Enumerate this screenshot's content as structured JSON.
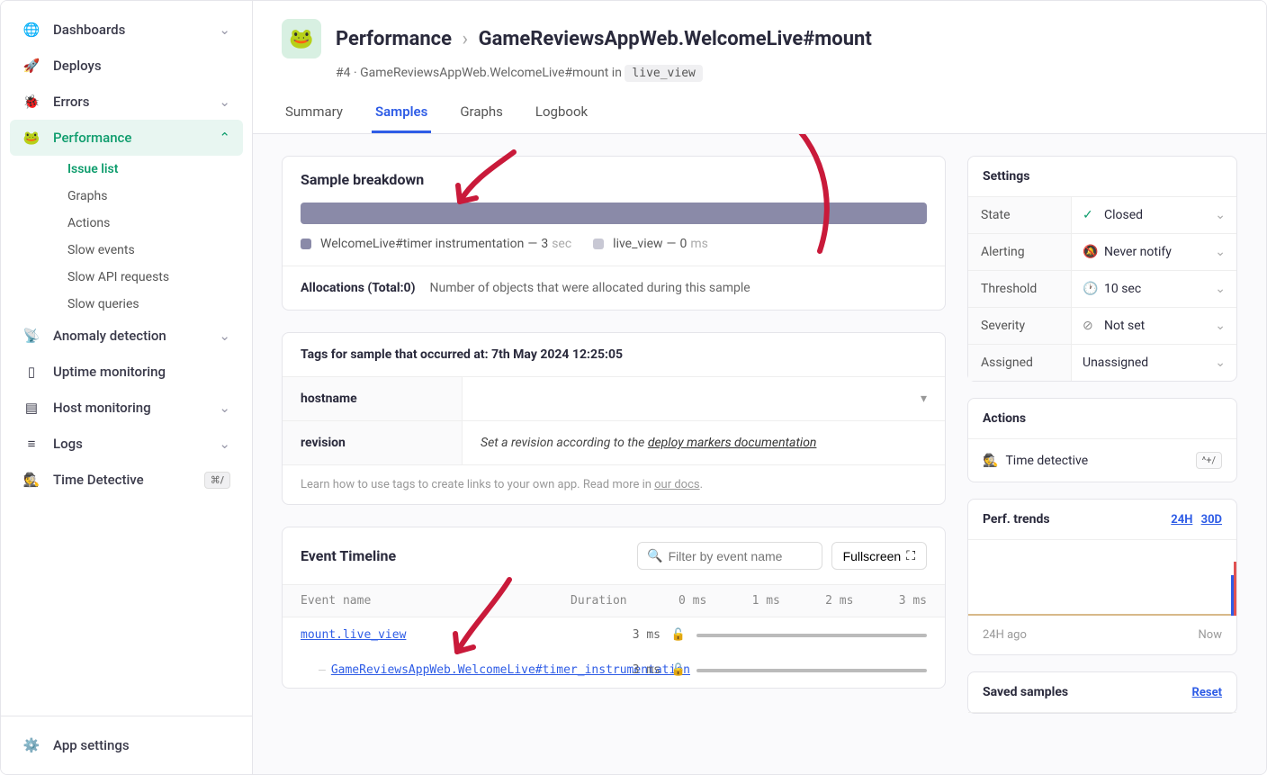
{
  "sidebar": {
    "items": [
      {
        "label": "Dashboards",
        "icon": "globe"
      },
      {
        "label": "Deploys",
        "icon": "rocket"
      },
      {
        "label": "Errors",
        "icon": "bug"
      },
      {
        "label": "Performance",
        "icon": "frog",
        "active": true
      },
      {
        "label": "Anomaly detection",
        "icon": "radar"
      },
      {
        "label": "Uptime monitoring",
        "icon": "monitor"
      },
      {
        "label": "Host monitoring",
        "icon": "server"
      },
      {
        "label": "Logs",
        "icon": "list"
      },
      {
        "label": "Time Detective",
        "icon": "detective",
        "kbd": "⌘/"
      }
    ],
    "perf_sub": [
      {
        "label": "Issue list",
        "active": true
      },
      {
        "label": "Graphs"
      },
      {
        "label": "Actions"
      },
      {
        "label": "Slow events"
      },
      {
        "label": "Slow API requests"
      },
      {
        "label": "Slow queries"
      }
    ],
    "settings_label": "App settings"
  },
  "header": {
    "breadcrumb_root": "Performance",
    "breadcrumb_page": "GameReviewsAppWeb.WelcomeLive#mount",
    "sub_prefix": "#4 · GameReviewsAppWeb.WelcomeLive#mount in",
    "sub_code": "live_view",
    "tabs": [
      "Summary",
      "Samples",
      "Graphs",
      "Logbook"
    ],
    "active_tab": "Samples"
  },
  "breakdown": {
    "title": "Sample breakdown",
    "legend": [
      {
        "color": "#8a8aa8",
        "label": "WelcomeLive#timer instrumentation",
        "value": "3",
        "unit": "sec"
      },
      {
        "color": "#c8c8d4",
        "label": "live_view",
        "value": "0",
        "unit": "ms"
      }
    ],
    "alloc_title": "Allocations (Total:0)",
    "alloc_desc": "Number of objects that were allocated during this sample"
  },
  "tags": {
    "title": "Tags for sample that occurred at: 7th May 2024 12:25:05",
    "rows": [
      {
        "key": "hostname",
        "value": ""
      },
      {
        "key": "revision",
        "value_prefix": "Set a revision according to the ",
        "value_link": "deploy markers documentation"
      }
    ],
    "footer_prefix": "Learn how to use tags to create links to your own app. Read more in ",
    "footer_link": "our docs",
    "footer_suffix": "."
  },
  "timeline": {
    "title": "Event Timeline",
    "filter_placeholder": "Filter by event name",
    "fullscreen_label": "Fullscreen",
    "col_event": "Event name",
    "col_duration": "Duration",
    "axis": [
      "0 ms",
      "1 ms",
      "2 ms",
      "3 ms"
    ],
    "rows": [
      {
        "name": "mount.live_view",
        "duration": "3 ms",
        "indent": false
      },
      {
        "name": "GameReviewsAppWeb.WelcomeLive#timer_instrumentation",
        "duration": "3 ms",
        "indent": true
      }
    ]
  },
  "settings": {
    "title": "Settings",
    "rows": [
      {
        "key": "State",
        "value": "Closed",
        "icon": "check-circle",
        "icon_class": "green"
      },
      {
        "key": "Alerting",
        "value": "Never notify",
        "icon": "bell-off"
      },
      {
        "key": "Threshold",
        "value": "10 sec",
        "icon": "clock"
      },
      {
        "key": "Severity",
        "value": "Not set",
        "icon": "none"
      },
      {
        "key": "Assigned",
        "value": "Unassigned",
        "icon": ""
      }
    ]
  },
  "actions": {
    "title": "Actions",
    "time_detective": "Time detective",
    "kbd": "^+/"
  },
  "trends": {
    "title": "Perf. trends",
    "links": [
      "24H",
      "30D"
    ],
    "foot_left": "24H ago",
    "foot_right": "Now"
  },
  "saved": {
    "title": "Saved samples",
    "reset": "Reset"
  }
}
